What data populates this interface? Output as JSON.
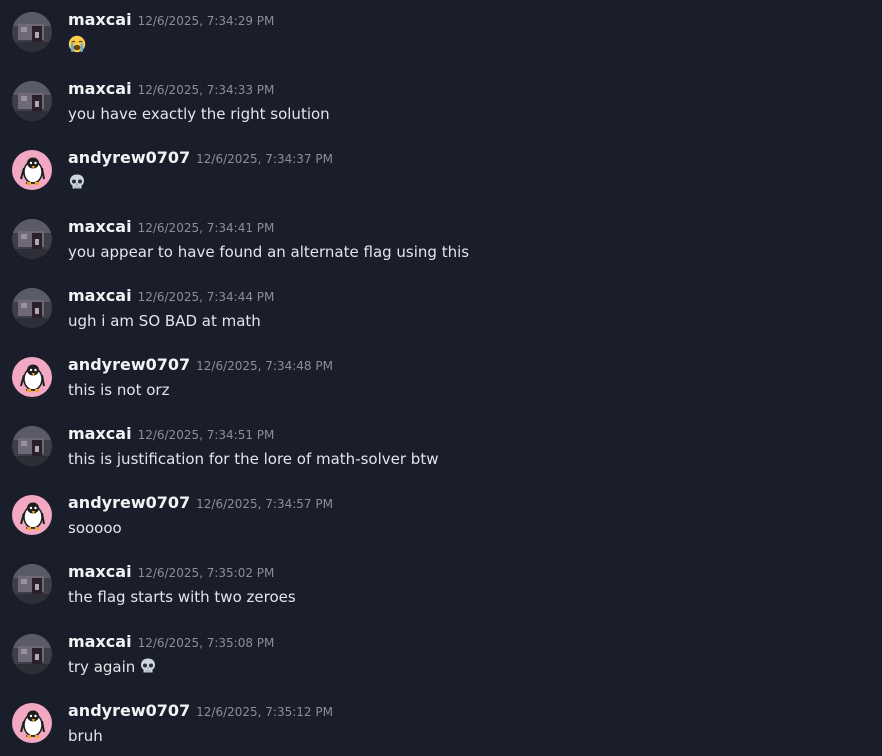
{
  "messages": [
    {
      "user": "maxcai",
      "time": "12/6/2025, 7:34:29 PM",
      "text": "",
      "emoji": "loudly-crying-face-emoji"
    },
    {
      "user": "maxcai",
      "time": "12/6/2025, 7:34:33 PM",
      "text": "you have exactly the right solution",
      "emoji": ""
    },
    {
      "user": "andyrew0707",
      "time": "12/6/2025, 7:34:37 PM",
      "text": "",
      "emoji": "skull-emoji"
    },
    {
      "user": "maxcai",
      "time": "12/6/2025, 7:34:41 PM",
      "text": "you appear to have found an alternate flag using this",
      "emoji": ""
    },
    {
      "user": "maxcai",
      "time": "12/6/2025, 7:34:44 PM",
      "text": "ugh i am SO BAD at math",
      "emoji": ""
    },
    {
      "user": "andyrew0707",
      "time": "12/6/2025, 7:34:48 PM",
      "text": "this is not orz",
      "emoji": ""
    },
    {
      "user": "maxcai",
      "time": "12/6/2025, 7:34:51 PM",
      "text": "this is justification for the lore of math-solver btw",
      "emoji": ""
    },
    {
      "user": "andyrew0707",
      "time": "12/6/2025, 7:34:57 PM",
      "text": "sooooo",
      "emoji": ""
    },
    {
      "user": "maxcai",
      "time": "12/6/2025, 7:35:02 PM",
      "text": "the flag starts with two zeroes",
      "emoji": ""
    },
    {
      "user": "maxcai",
      "time": "12/6/2025, 7:35:08 PM",
      "text": "try again",
      "emoji": "skull-emoji"
    },
    {
      "user": "andyrew0707",
      "time": "12/6/2025, 7:35:12 PM",
      "text": "bruh",
      "emoji": ""
    }
  ],
  "colors": {
    "background": "#1a1d2a",
    "username": "#f2f3f5",
    "timestamp": "#8a8e9b",
    "message_text": "#e3e5ea",
    "andyrew_avatar_bg": "#f2a7c3"
  },
  "avatars": {
    "maxcai": "maxcai-avatar",
    "andyrew0707": "andyrew0707-penguin-avatar"
  }
}
